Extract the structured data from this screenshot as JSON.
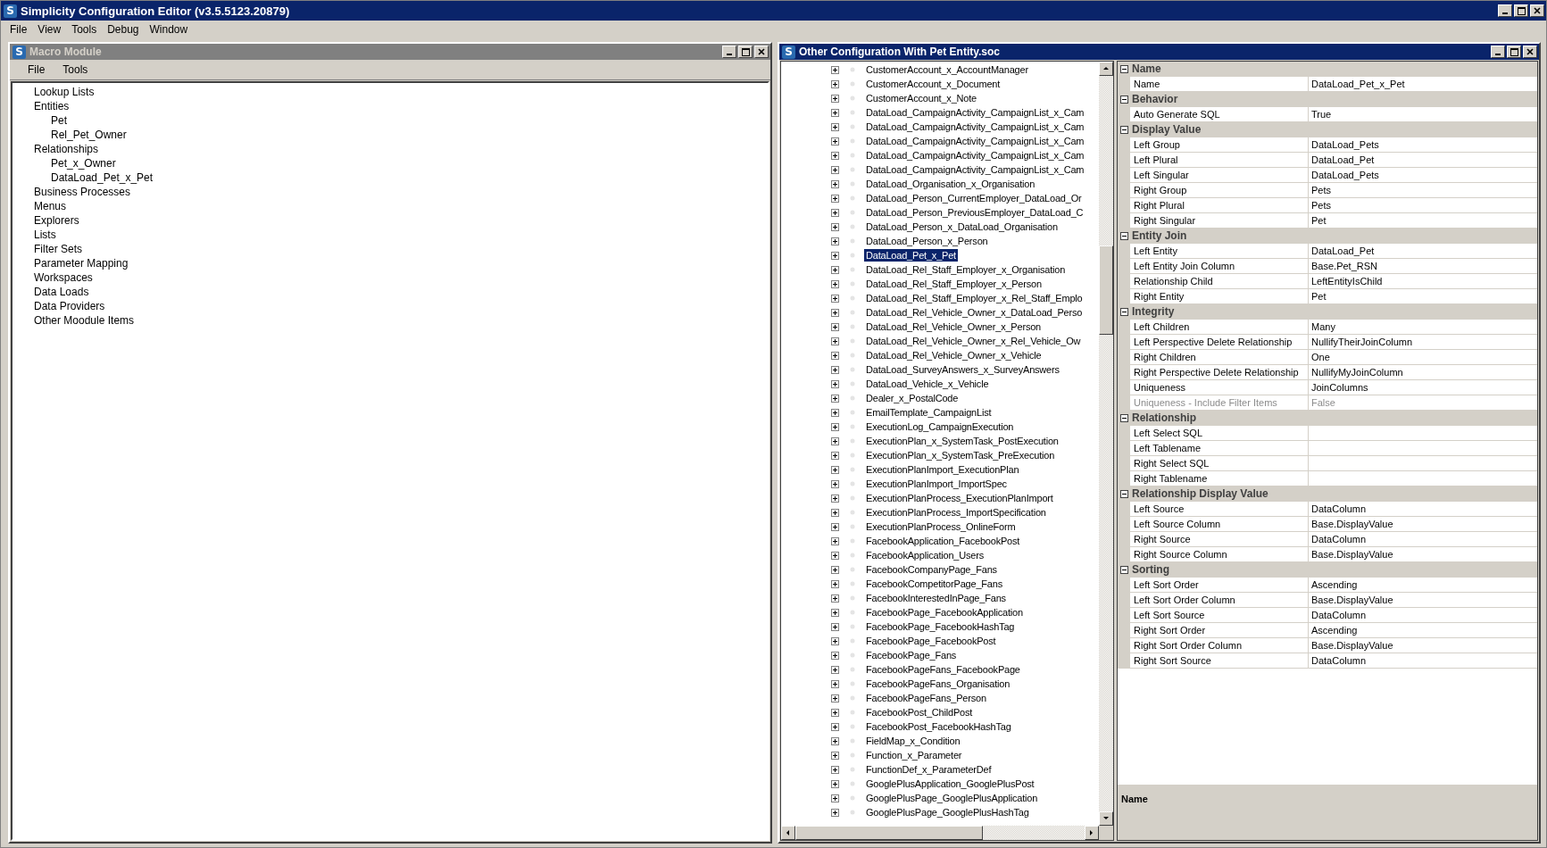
{
  "app": {
    "icon_letter": "S",
    "title": "Simplicity Configuration Editor (v3.5.5123.20879)",
    "menu": [
      "File",
      "View",
      "Tools",
      "Debug",
      "Window"
    ]
  },
  "macro_window": {
    "icon_letter": "S",
    "title": "Macro Module",
    "active": false,
    "menu": [
      "File",
      "Tools"
    ],
    "tree": [
      {
        "label": "Lookup Lists"
      },
      {
        "label": "Entities",
        "children": [
          {
            "label": "Pet"
          },
          {
            "label": "Rel_Pet_Owner"
          }
        ]
      },
      {
        "label": "Relationships",
        "children": [
          {
            "label": "Pet_x_Owner"
          },
          {
            "label": "DataLoad_Pet_x_Pet"
          }
        ]
      },
      {
        "label": "Business Processes"
      },
      {
        "label": "Menus"
      },
      {
        "label": "Explorers"
      },
      {
        "label": "Lists"
      },
      {
        "label": "Filter Sets"
      },
      {
        "label": "Parameter Mapping"
      },
      {
        "label": "Workspaces"
      },
      {
        "label": "Data Loads"
      },
      {
        "label": "Data Providers"
      },
      {
        "label": "Other Moodule Items"
      }
    ]
  },
  "config_window": {
    "icon_letter": "S",
    "title": "Other Configuration With Pet Entity.soc",
    "active": true,
    "tree": [
      {
        "label": "CustomerAccount_x_AccountManager",
        "selected": false
      },
      {
        "label": "CustomerAccount_x_Document",
        "selected": false
      },
      {
        "label": "CustomerAccount_x_Note",
        "selected": false
      },
      {
        "label": "DataLoad_CampaignActivity_CampaignList_x_Cam",
        "selected": false
      },
      {
        "label": "DataLoad_CampaignActivity_CampaignList_x_Cam",
        "selected": false
      },
      {
        "label": "DataLoad_CampaignActivity_CampaignList_x_Cam",
        "selected": false
      },
      {
        "label": "DataLoad_CampaignActivity_CampaignList_x_Cam",
        "selected": false
      },
      {
        "label": "DataLoad_CampaignActivity_CampaignList_x_Cam",
        "selected": false
      },
      {
        "label": "DataLoad_Organisation_x_Organisation",
        "selected": false
      },
      {
        "label": "DataLoad_Person_CurrentEmployer_DataLoad_Or",
        "selected": false
      },
      {
        "label": "DataLoad_Person_PreviousEmployer_DataLoad_C",
        "selected": false
      },
      {
        "label": "DataLoad_Person_x_DataLoad_Organisation",
        "selected": false
      },
      {
        "label": "DataLoad_Person_x_Person",
        "selected": false
      },
      {
        "label": "DataLoad_Pet_x_Pet",
        "selected": true
      },
      {
        "label": "DataLoad_Rel_Staff_Employer_x_Organisation",
        "selected": false
      },
      {
        "label": "DataLoad_Rel_Staff_Employer_x_Person",
        "selected": false
      },
      {
        "label": "DataLoad_Rel_Staff_Employer_x_Rel_Staff_Emplo",
        "selected": false
      },
      {
        "label": "DataLoad_Rel_Vehicle_Owner_x_DataLoad_Perso",
        "selected": false
      },
      {
        "label": "DataLoad_Rel_Vehicle_Owner_x_Person",
        "selected": false
      },
      {
        "label": "DataLoad_Rel_Vehicle_Owner_x_Rel_Vehicle_Ow",
        "selected": false
      },
      {
        "label": "DataLoad_Rel_Vehicle_Owner_x_Vehicle",
        "selected": false
      },
      {
        "label": "DataLoad_SurveyAnswers_x_SurveyAnswers",
        "selected": false
      },
      {
        "label": "DataLoad_Vehicle_x_Vehicle",
        "selected": false
      },
      {
        "label": "Dealer_x_PostalCode",
        "selected": false
      },
      {
        "label": "EmailTemplate_CampaignList",
        "selected": false
      },
      {
        "label": "ExecutionLog_CampaignExecution",
        "selected": false
      },
      {
        "label": "ExecutionPlan_x_SystemTask_PostExecution",
        "selected": false
      },
      {
        "label": "ExecutionPlan_x_SystemTask_PreExecution",
        "selected": false
      },
      {
        "label": "ExecutionPlanImport_ExecutionPlan",
        "selected": false
      },
      {
        "label": "ExecutionPlanImport_ImportSpec",
        "selected": false
      },
      {
        "label": "ExecutionPlanProcess_ExecutionPlanImport",
        "selected": false
      },
      {
        "label": "ExecutionPlanProcess_ImportSpecification",
        "selected": false
      },
      {
        "label": "ExecutionPlanProcess_OnlineForm",
        "selected": false
      },
      {
        "label": "FacebookApplication_FacebookPost",
        "selected": false
      },
      {
        "label": "FacebookApplication_Users",
        "selected": false
      },
      {
        "label": "FacebookCompanyPage_Fans",
        "selected": false
      },
      {
        "label": "FacebookCompetitorPage_Fans",
        "selected": false
      },
      {
        "label": "FacebookInterestedInPage_Fans",
        "selected": false
      },
      {
        "label": "FacebookPage_FacebookApplication",
        "selected": false
      },
      {
        "label": "FacebookPage_FacebookHashTag",
        "selected": false
      },
      {
        "label": "FacebookPage_FacebookPost",
        "selected": false
      },
      {
        "label": "FacebookPage_Fans",
        "selected": false
      },
      {
        "label": "FacebookPageFans_FacebookPage",
        "selected": false
      },
      {
        "label": "FacebookPageFans_Organisation",
        "selected": false
      },
      {
        "label": "FacebookPageFans_Person",
        "selected": false
      },
      {
        "label": "FacebookPost_ChildPost",
        "selected": false
      },
      {
        "label": "FacebookPost_FacebookHashTag",
        "selected": false
      },
      {
        "label": "FieldMap_x_Condition",
        "selected": false
      },
      {
        "label": "Function_x_Parameter",
        "selected": false
      },
      {
        "label": "FunctionDef_x_ParameterDef",
        "selected": false
      },
      {
        "label": "GooglePlusApplication_GooglePlusPost",
        "selected": false
      },
      {
        "label": "GooglePlusPage_GooglePlusApplication",
        "selected": false
      },
      {
        "label": "GooglePlusPage_GooglePlusHashTag",
        "selected": false
      }
    ],
    "properties": [
      {
        "category": "Name",
        "expanded": true,
        "rows": [
          {
            "name": "Name",
            "value": "DataLoad_Pet_x_Pet",
            "disabled": false
          }
        ]
      },
      {
        "category": "Behavior",
        "expanded": true,
        "rows": [
          {
            "name": "Auto Generate SQL",
            "value": "True",
            "disabled": false
          }
        ]
      },
      {
        "category": "Display Value",
        "expanded": true,
        "rows": [
          {
            "name": "Left Group",
            "value": "DataLoad_Pets",
            "disabled": false
          },
          {
            "name": "Left Plural",
            "value": "DataLoad_Pet",
            "disabled": false
          },
          {
            "name": "Left Singular",
            "value": "DataLoad_Pets",
            "disabled": false
          },
          {
            "name": "Right Group",
            "value": "Pets",
            "disabled": false
          },
          {
            "name": "Right Plural",
            "value": "Pets",
            "disabled": false
          },
          {
            "name": "Right Singular",
            "value": "Pet",
            "disabled": false
          }
        ]
      },
      {
        "category": "Entity Join",
        "expanded": true,
        "rows": [
          {
            "name": "Left Entity",
            "value": "DataLoad_Pet",
            "disabled": false
          },
          {
            "name": "Left Entity Join Column",
            "value": "Base.Pet_RSN",
            "disabled": false
          },
          {
            "name": "Relationship Child",
            "value": "LeftEntityIsChild",
            "disabled": false
          },
          {
            "name": "Right Entity",
            "value": "Pet",
            "disabled": false
          }
        ]
      },
      {
        "category": "Integrity",
        "expanded": true,
        "rows": [
          {
            "name": "Left Children",
            "value": "Many",
            "disabled": false
          },
          {
            "name": "Left Perspective Delete Relationship",
            "value": "NullifyTheirJoinColumn",
            "disabled": false
          },
          {
            "name": "Right Children",
            "value": "One",
            "disabled": false
          },
          {
            "name": "Right Perspective Delete Relationship",
            "value": "NullifyMyJoinColumn",
            "disabled": false
          },
          {
            "name": "Uniqueness",
            "value": "JoinColumns",
            "disabled": false
          },
          {
            "name": "Uniqueness - Include Filter Items",
            "value": "False",
            "disabled": true
          }
        ]
      },
      {
        "category": "Relationship",
        "expanded": true,
        "rows": [
          {
            "name": "Left Select SQL",
            "disabled": false
          },
          {
            "name": "Left Tablename",
            "disabled": false
          },
          {
            "name": "Right Select SQL",
            "disabled": false
          },
          {
            "name": "Right Tablename",
            "disabled": false
          }
        ]
      },
      {
        "category": "Relationship Display Value",
        "expanded": true,
        "rows": [
          {
            "name": "Left Source",
            "value": "DataColumn",
            "disabled": false
          },
          {
            "name": "Left Source Column",
            "value": "Base.DisplayValue",
            "disabled": false
          },
          {
            "name": "Right Source",
            "value": "DataColumn",
            "disabled": false
          },
          {
            "name": "Right Source Column",
            "value": "Base.DisplayValue",
            "disabled": false
          }
        ]
      },
      {
        "category": "Sorting",
        "expanded": true,
        "rows": [
          {
            "name": "Left Sort Order",
            "value": "Ascending",
            "disabled": false
          },
          {
            "name": "Left Sort Order Column",
            "value": "Base.DisplayValue",
            "disabled": false
          },
          {
            "name": "Left Sort Source",
            "value": "DataColumn",
            "disabled": false
          },
          {
            "name": "Right Sort Order",
            "value": "Ascending",
            "disabled": false
          },
          {
            "name": "Right Sort Order Column",
            "value": "Base.DisplayValue",
            "disabled": false
          },
          {
            "name": "Right Sort Source",
            "value": "DataColumn",
            "disabled": false
          }
        ]
      }
    ],
    "description_title": "Name"
  }
}
